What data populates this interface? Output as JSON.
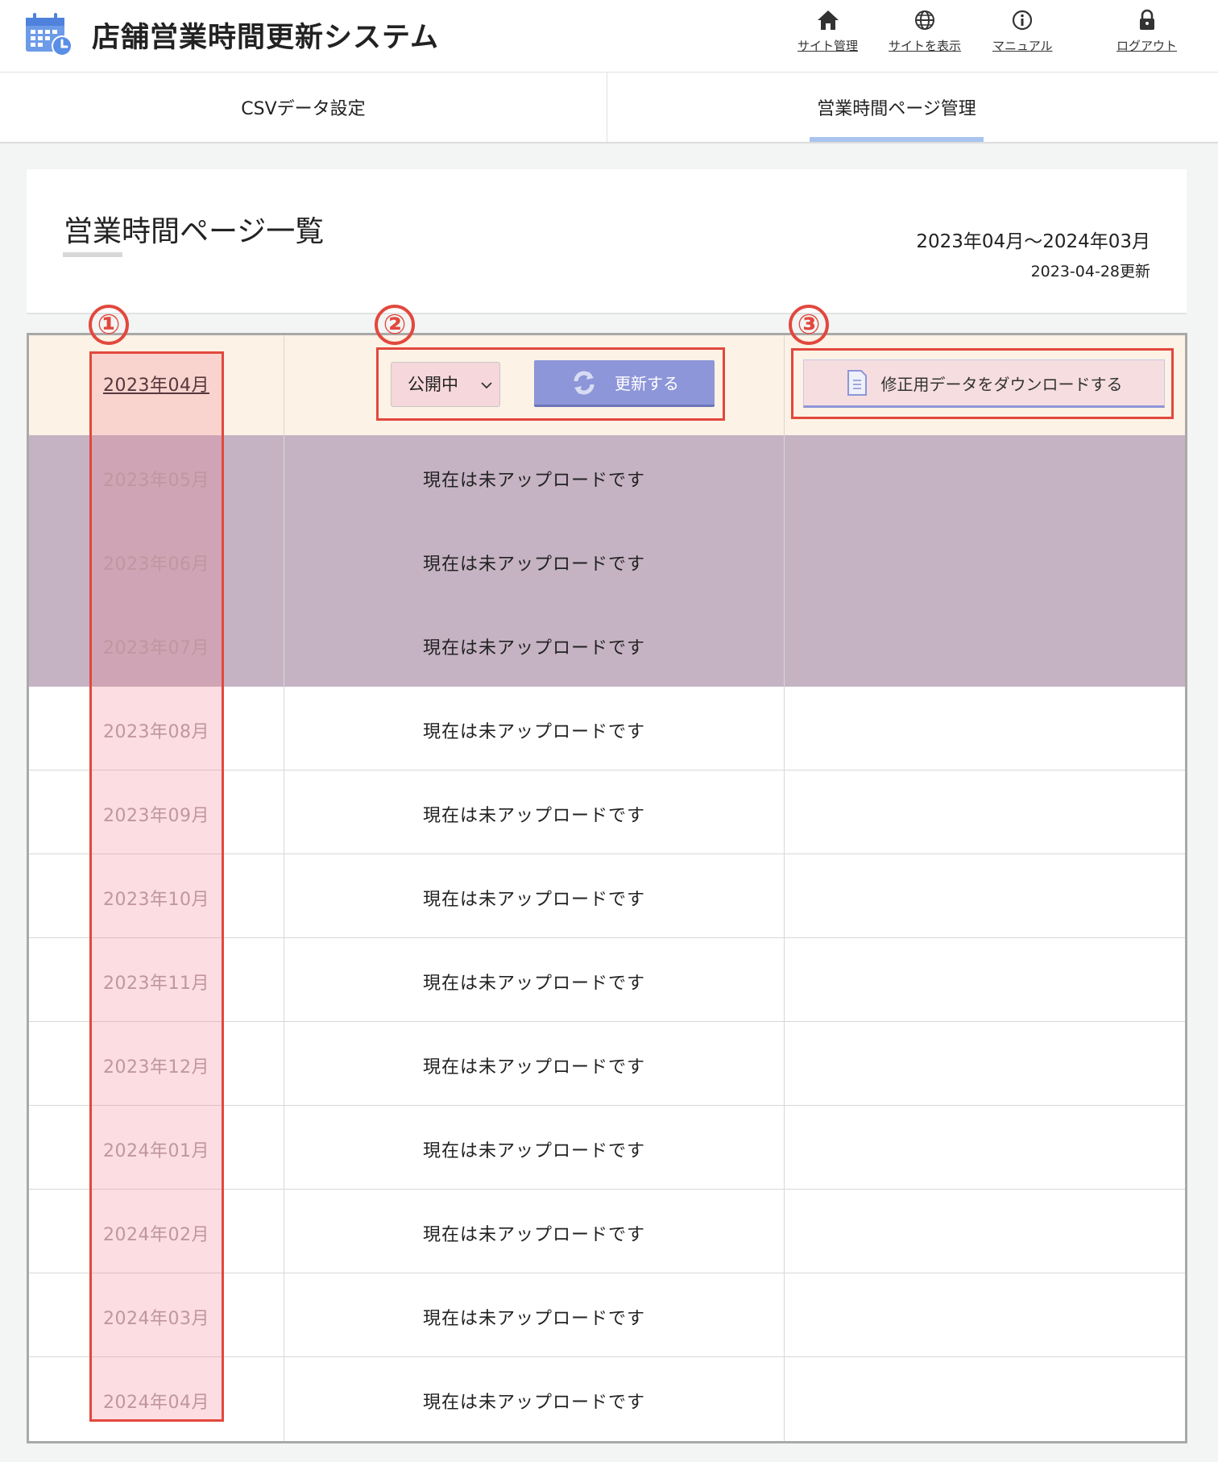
{
  "header": {
    "app_title": "店舗営業時間更新システム",
    "nav": [
      {
        "label": "サイト管理",
        "icon": "home-icon"
      },
      {
        "label": "サイトを表示",
        "icon": "globe-icon"
      },
      {
        "label": "マニュアル",
        "icon": "info-icon"
      },
      {
        "label": "ログアウト",
        "icon": "lock-icon"
      }
    ]
  },
  "tabs": [
    {
      "label": "CSVデータ設定",
      "active": false
    },
    {
      "label": "営業時間ページ管理",
      "active": true
    }
  ],
  "page": {
    "title": "営業時間ページ一覧",
    "period": "2023年04月〜2024年03月",
    "updated": "2023-04-28更新"
  },
  "table": {
    "first_row": {
      "month": "2023年04月",
      "status_select": "公開中",
      "update_button": "更新する",
      "download_button": "修正用データをダウンロードする"
    },
    "rows": [
      {
        "month": "2023年05月",
        "message": "現在は未アップロードです"
      },
      {
        "month": "2023年06月",
        "message": "現在は未アップロードです"
      },
      {
        "month": "2023年07月",
        "message": "現在は未アップロードです"
      },
      {
        "month": "2023年08月",
        "message": "現在は未アップロードです"
      },
      {
        "month": "2023年09月",
        "message": "現在は未アップロードです"
      },
      {
        "month": "2023年10月",
        "message": "現在は未アップロードです"
      },
      {
        "month": "2023年11月",
        "message": "現在は未アップロードです"
      },
      {
        "month": "2023年12月",
        "message": "現在は未アップロードです"
      },
      {
        "month": "2024年01月",
        "message": "現在は未アップロードです"
      },
      {
        "month": "2024年02月",
        "message": "現在は未アップロードです"
      },
      {
        "month": "2024年03月",
        "message": "現在は未アップロードです"
      },
      {
        "month": "2024年04月",
        "message": "現在は未アップロードです"
      }
    ]
  },
  "annotations": [
    "①",
    "②",
    "③"
  ],
  "colors": {
    "accent_blue": "#8d96d8",
    "tab_active": "#a9c4ee",
    "annotation_red": "#e2483d",
    "highlight_row": "#c5b3c3",
    "first_row_bg": "#fcf2e5"
  }
}
